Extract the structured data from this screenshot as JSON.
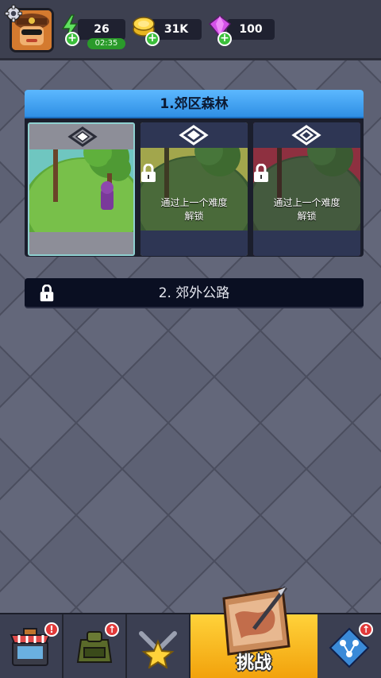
{
  "resources": {
    "energy": "26",
    "energy_timer": "02:35",
    "gold": "31K",
    "gems": "100"
  },
  "chapters": [
    {
      "title": "1.郊区森林",
      "locked": false,
      "difficulties": [
        {
          "name": "difficulty-1",
          "locked": false
        },
        {
          "name": "difficulty-2",
          "locked": true,
          "message_line1": "通过上一个难度",
          "message_line2": "解锁"
        },
        {
          "name": "difficulty-3",
          "locked": true,
          "message_line1": "通过上一个难度",
          "message_line2": "解锁"
        }
      ]
    },
    {
      "title": "2. 郊外公路",
      "locked": true
    }
  ],
  "nav": {
    "active_label": "挑战",
    "items": [
      "shop-icon",
      "backpack-icon",
      "weapons-star-icon",
      "challenge-map-icon",
      "skill-tree-icon"
    ]
  },
  "colors": {
    "header_blue": "#3d9bf0",
    "card_tint_yellow": "#c9b24a",
    "card_tint_red": "#b03a46",
    "active_tab": "#f7b51c"
  }
}
